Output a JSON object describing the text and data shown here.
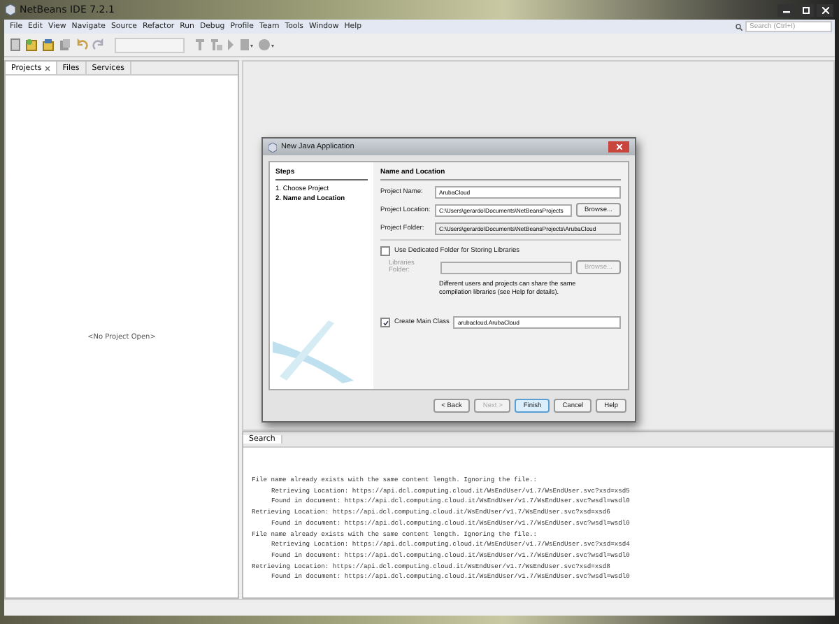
{
  "window": {
    "title": "NetBeans IDE 7.2.1"
  },
  "menu": [
    "File",
    "Edit",
    "View",
    "Navigate",
    "Source",
    "Refactor",
    "Run",
    "Debug",
    "Profile",
    "Team",
    "Tools",
    "Window",
    "Help"
  ],
  "search": {
    "placeholder": "Search (Ctrl+I)"
  },
  "side_tabs": [
    {
      "label": "Projects",
      "selected": true,
      "closable": true
    },
    {
      "label": "Files",
      "selected": false,
      "closable": false
    },
    {
      "label": "Services",
      "selected": false,
      "closable": false
    }
  ],
  "side_empty": "<No Project Open>",
  "output": {
    "tab": "Search",
    "lines": [
      {
        "text": "File name already exists with the same content length. Ignoring the file.:",
        "indent": false
      },
      {
        "text": "Retrieving Location: https://api.dcl.computing.cloud.it/WsEndUser/v1.7/WsEndUser.svc?xsd=xsd5",
        "indent": true
      },
      {
        "text": "Found in document: https://api.dcl.computing.cloud.it/WsEndUser/v1.7/WsEndUser.svc?wsdl=wsdl0",
        "indent": true
      },
      {
        "text": "Retrieving Location: https://api.dcl.computing.cloud.it/WsEndUser/v1.7/WsEndUser.svc?xsd=xsd6",
        "indent": false
      },
      {
        "text": "Found in document: https://api.dcl.computing.cloud.it/WsEndUser/v1.7/WsEndUser.svc?wsdl=wsdl0",
        "indent": true
      },
      {
        "text": "File name already exists with the same content length. Ignoring the file.:",
        "indent": false
      },
      {
        "text": "Retrieving Location: https://api.dcl.computing.cloud.it/WsEndUser/v1.7/WsEndUser.svc?xsd=xsd4",
        "indent": true
      },
      {
        "text": "Found in document: https://api.dcl.computing.cloud.it/WsEndUser/v1.7/WsEndUser.svc?wsdl=wsdl0",
        "indent": true
      },
      {
        "text": "Retrieving Location: https://api.dcl.computing.cloud.it/WsEndUser/v1.7/WsEndUser.svc?xsd=xsd8",
        "indent": false
      },
      {
        "text": "Found in document: https://api.dcl.computing.cloud.it/WsEndUser/v1.7/WsEndUser.svc?wsdl=wsdl0",
        "indent": true
      }
    ]
  },
  "dialog": {
    "title": "New Java Application",
    "steps_title": "Steps",
    "steps": [
      {
        "label": "1.  Choose Project",
        "selected": false
      },
      {
        "label": "2.  Name and Location",
        "selected": true
      }
    ],
    "heading": "Name and Location",
    "fields": [
      {
        "label": "Project Name:",
        "value": "ArubaCloud",
        "editable": true
      },
      {
        "label": "Project Location:",
        "value": "C:\\Users\\gerardo\\Documents\\NetBeansProjects",
        "editable": true,
        "browse": "Browse..."
      },
      {
        "label": "Project Folder:",
        "value": "C:\\Users\\gerardo\\Documents\\NetBeansProjects\\ArubaCloud",
        "editable": false
      }
    ],
    "libraries": {
      "label": "Use Dedicated Folder for Storing Libraries",
      "checked": false,
      "folder_label": "Libraries Folder:",
      "browse": "Browse...",
      "help": "Different users and projects can share the same compilation libraries (see Help for details)."
    },
    "main_class": {
      "label": "Create Main Class",
      "checked": true,
      "value": "arubacloud.ArubaCloud"
    },
    "buttons": [
      {
        "label": "< Back",
        "disabled": false,
        "default": false
      },
      {
        "label": "Next >",
        "disabled": true,
        "default": false
      },
      {
        "label": "Finish",
        "disabled": false,
        "default": true
      },
      {
        "label": "Cancel",
        "disabled": false,
        "default": false
      },
      {
        "label": "Help",
        "disabled": false,
        "default": false
      }
    ]
  }
}
